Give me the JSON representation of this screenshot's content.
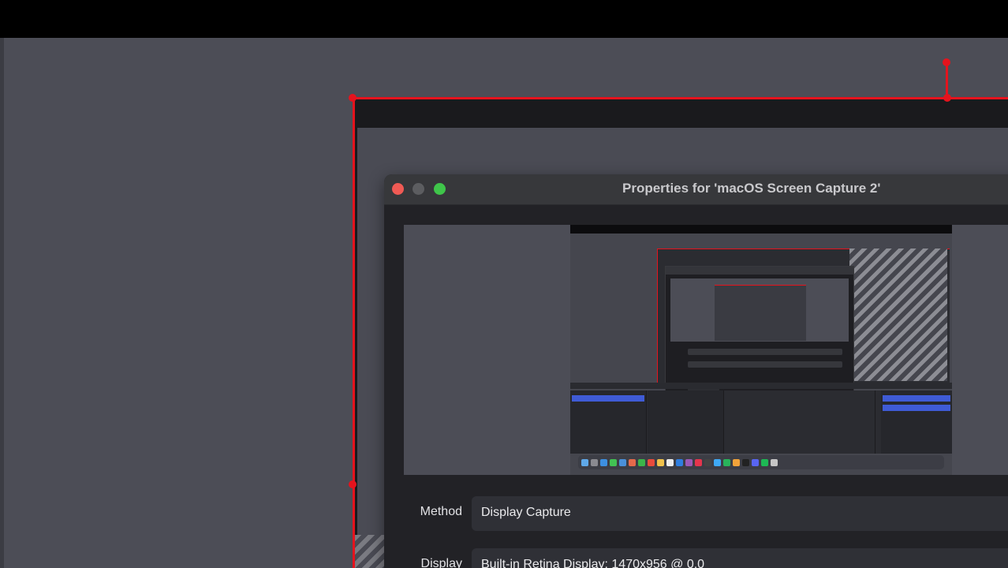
{
  "window": {
    "title": "Properties for 'macOS Screen Capture 2'"
  },
  "form": {
    "method_label": "Method",
    "method_value": "Display Capture",
    "display_label": "Display",
    "display_value": "Built-in Retina Display: 1470x956 @ 0,0"
  },
  "colors": {
    "selection_red": "#e5131d",
    "close": "#f05a54",
    "maximize": "#3fc54a",
    "accent_blue": "#3f5bd6"
  },
  "icons": [
    "close-dot-icon",
    "minimize-dot-icon",
    "maximize-dot-icon",
    "transform-handle-icon"
  ]
}
